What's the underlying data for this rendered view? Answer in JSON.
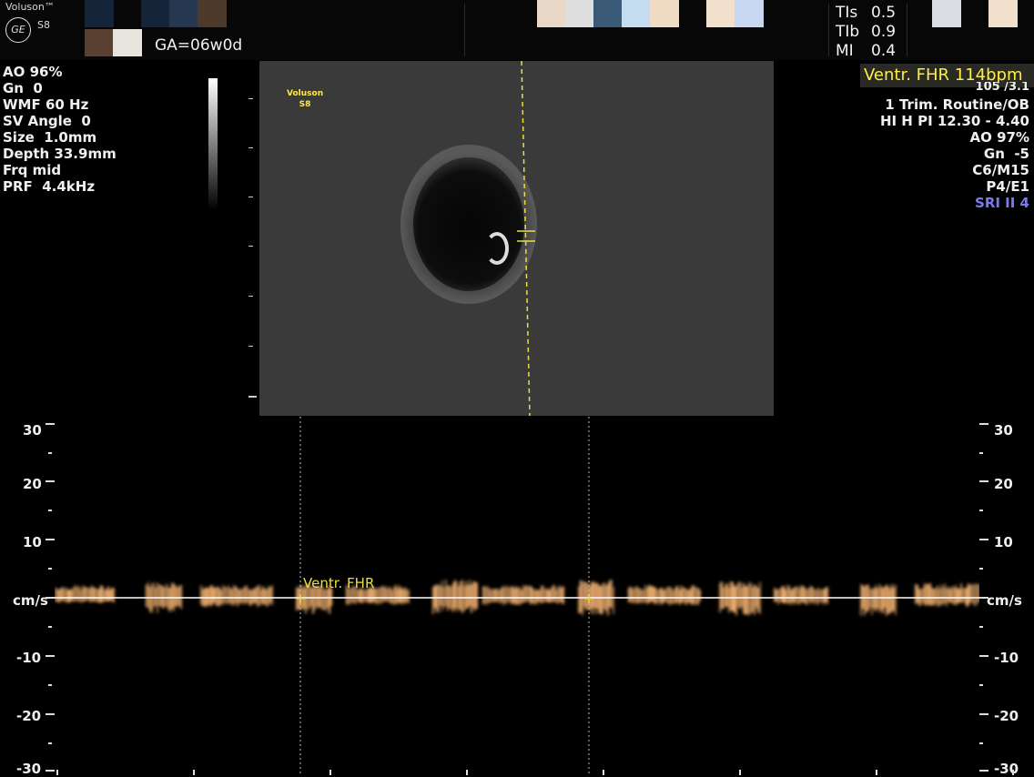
{
  "header": {
    "brand": "Voluson™",
    "logo": "GE",
    "model": "S8",
    "ga": "GA=06w0d",
    "indices": [
      {
        "label": "TIs",
        "value": "0.5"
      },
      {
        "label": "TIb",
        "value": "0.9"
      },
      {
        "label": "MI",
        "value": "0.4"
      }
    ],
    "swatch_colors_left": [
      "#1a2a40",
      "#1a2a40",
      "#2a3a52",
      "#5a4030",
      "#5a4030",
      "#e8e8e0"
    ],
    "swatch_colors_right": [
      "#e8d8c8",
      "#e0e0e0",
      "#3a5a78",
      "#c8e0f0",
      "#f0dcc8",
      "#f0e0d0",
      "#c8d8f0",
      "#e0e0e8",
      "#f0e0d0"
    ]
  },
  "left_params": {
    "ao": "AO 96%",
    "gn": "Gn  0",
    "wmf": "WMF 60 Hz",
    "sv_angle": "SV Angle  0",
    "size": "Size  1.0mm",
    "depth": "Depth 33.9mm",
    "frq": "Frq mid",
    "prf": "PRF  4.4kHz"
  },
  "right_params": {
    "fhr": "Ventr. FHR 114bpm",
    "partial": "105 /3.1",
    "trim": "1 Trim. Routine/OB",
    "hi": "HI H PI 12.30 - 4.40",
    "ao": "AO 97%",
    "gn": "Gn  -5",
    "c": "C6/M15",
    "p": "P4/E1",
    "sri": "SRI II 4"
  },
  "bmode": {
    "logo_line1": "Voluson",
    "logo_line2": "S8"
  },
  "spectral": {
    "unit": "cm/s",
    "caliper_label": "Ventr. FHR",
    "y_labels": [
      "30",
      "20",
      "10",
      "cm/s",
      "-10",
      "-20",
      "-30"
    ]
  },
  "colors": {
    "accent_yellow": "#ffee40",
    "doppler_orange": "#f0b070",
    "sri_blue": "#7a7af0"
  }
}
